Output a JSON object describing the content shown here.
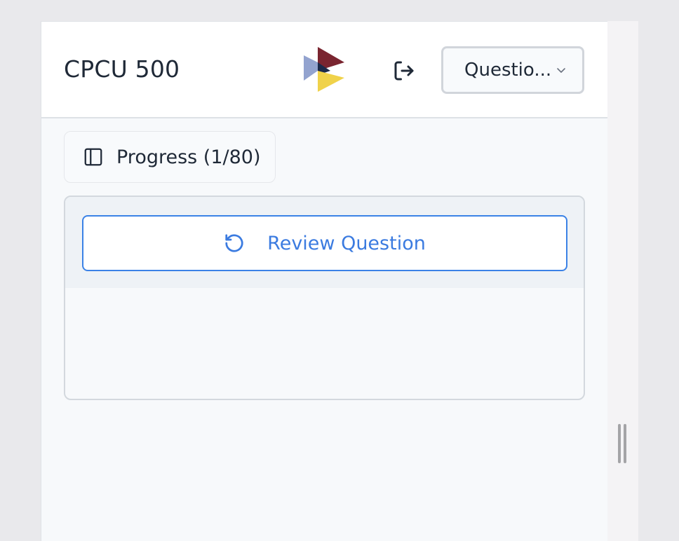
{
  "header": {
    "title": "CPCU 500",
    "question_select": {
      "selected": "Questio..."
    }
  },
  "toolbar": {
    "progress_label": "Progress (1/80)"
  },
  "card": {
    "review_label": "Review Question"
  },
  "icons": {
    "logo": "brand-logo",
    "logout": "logout-icon",
    "chevron": "chevron-down-icon",
    "sidebar": "sidebar-panel-icon",
    "review": "rotate-ccw-icon"
  },
  "colors": {
    "accent": "#3b82e6",
    "logo_red": "#7a2530",
    "logo_blue": "#93a3cf",
    "logo_navy": "#1c2a4a",
    "logo_yellow": "#f0d24a"
  }
}
